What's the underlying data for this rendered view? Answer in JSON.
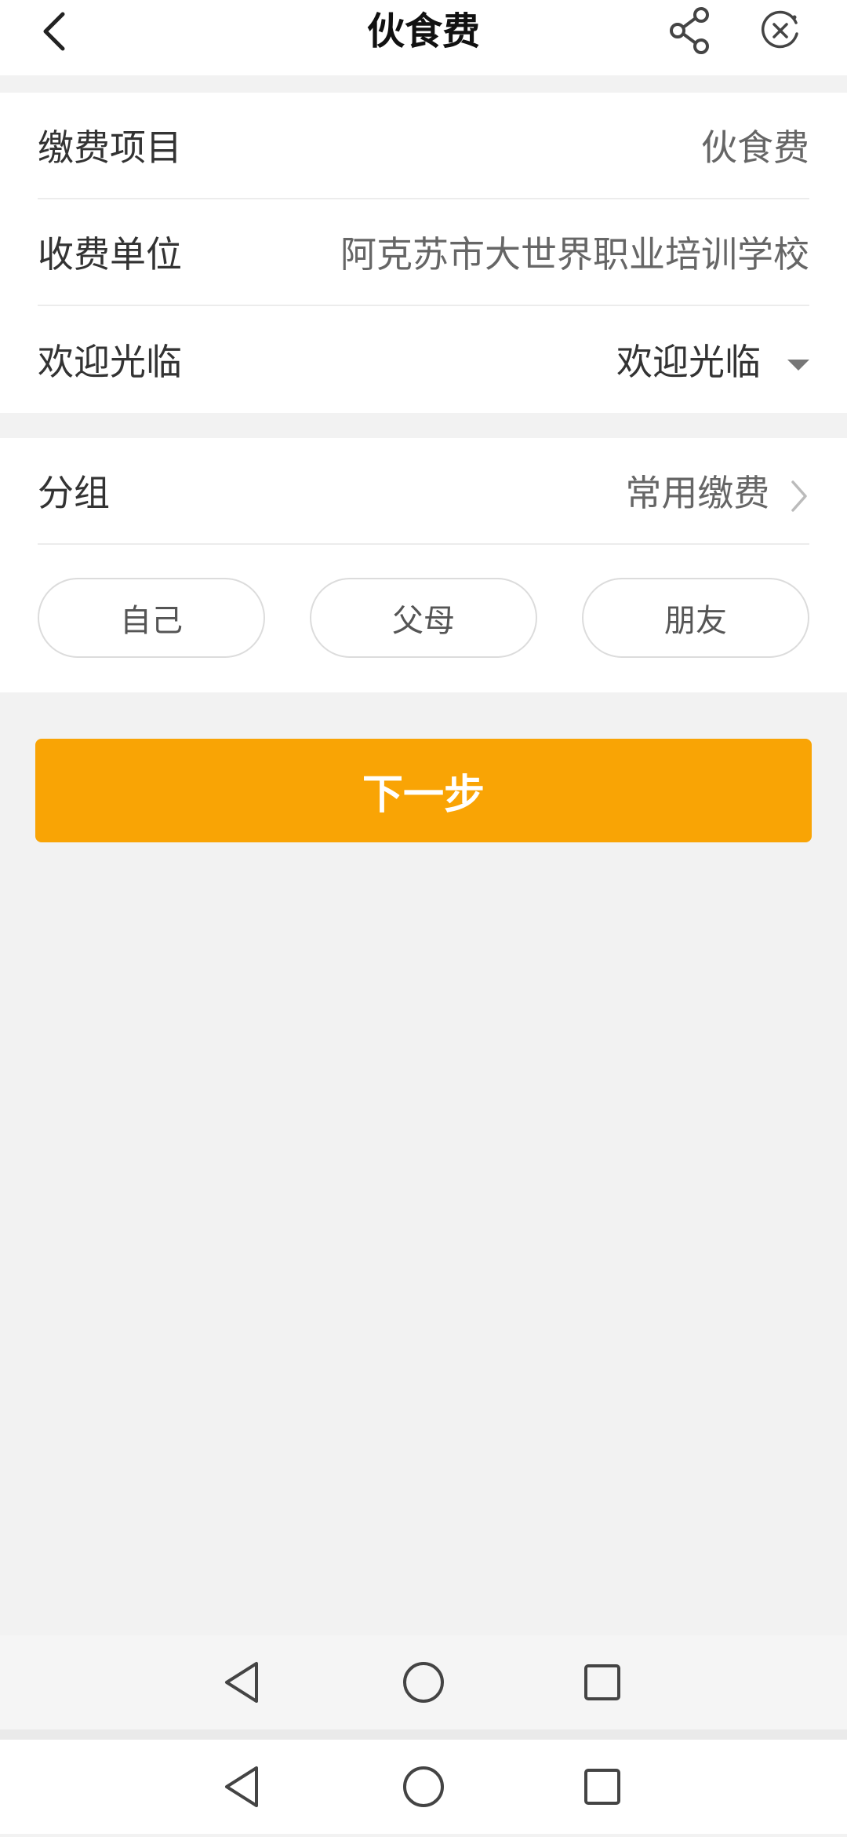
{
  "header": {
    "title": "伙食费",
    "icons": {
      "back": "back-arrow-icon",
      "share": "share-icon",
      "close": "close-circle-icon"
    }
  },
  "form": {
    "rows": [
      {
        "label": "缴费项目",
        "value": "伙食费"
      },
      {
        "label": "收费单位",
        "value": "阿克苏市大世界职业培训学校"
      },
      {
        "label": "欢迎光临",
        "value": "欢迎光临"
      }
    ]
  },
  "group": {
    "label": "分组",
    "value": "常用缴费",
    "chips": [
      "自己",
      "父母",
      "朋友"
    ]
  },
  "next_button": {
    "label": "下一步"
  },
  "colors": {
    "accent": "#f9a405",
    "background": "#f2f2f2",
    "card": "#ffffff"
  },
  "system_nav": {
    "icons": [
      "nav-back-icon",
      "nav-home-icon",
      "nav-recents-icon"
    ]
  }
}
